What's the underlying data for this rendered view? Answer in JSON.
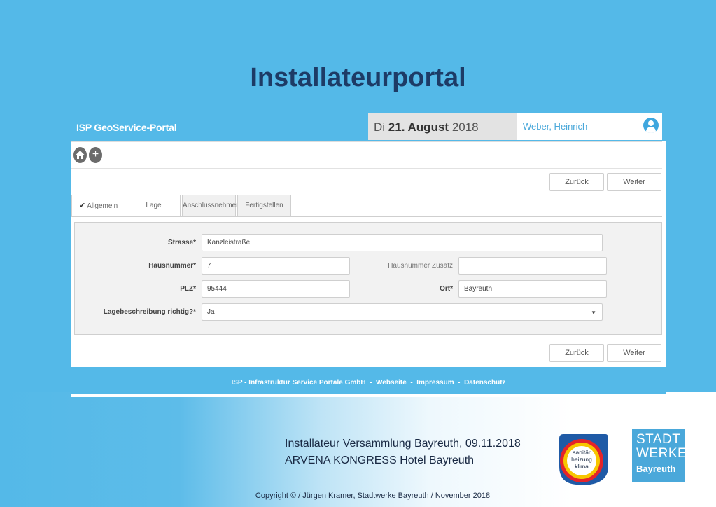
{
  "slide": {
    "title": "Installateurportal",
    "event_line1": "Installateur Versammlung Bayreuth, 09.11.2018",
    "event_line2": "ARVENA KONGRESS Hotel Bayreuth",
    "copyright": "Copyright © / Jürgen Kramer, Stadtwerke Bayreuth / November 2018"
  },
  "portal": {
    "brand": "ISP GeoService-Portal",
    "date_prefix": "Di",
    "date_bold": "21. August",
    "date_year": "2018",
    "user_name": "Weber, Heinrich",
    "home_icon": "home-icon",
    "add_icon": "plus-icon",
    "user_icon": "user-icon"
  },
  "nav": {
    "back_label": "Zurück",
    "next_label": "Weiter"
  },
  "tabs": [
    {
      "label": "Allgemein",
      "checked": true
    },
    {
      "label": "Lage",
      "active": true
    },
    {
      "label": "Anschlussnehmer"
    },
    {
      "label": "Fertigstellen"
    }
  ],
  "form": {
    "street_label": "Strasse*",
    "street_value": "Kanzleistraße",
    "house_label": "Hausnummer*",
    "house_value": "7",
    "house_extra_label": "Hausnummer Zusatz",
    "house_extra_value": "",
    "zip_label": "PLZ*",
    "zip_value": "95444",
    "city_label": "Ort*",
    "city_value": "Bayreuth",
    "location_label": "Lagebeschreibung richtig?*",
    "location_value": "Ja"
  },
  "footer": {
    "company": "ISP - Infrastruktur Service Portale GmbH",
    "sep": "-",
    "website": "Webseite",
    "imprint": "Impressum",
    "privacy": "Datenschutz"
  },
  "logos": {
    "shk_line1": "sanitär",
    "shk_line2": "heizung",
    "shk_line3": "klima",
    "sw_line1": "STADT",
    "sw_line2": "WERKE",
    "sw_line3": "Bayreuth"
  }
}
